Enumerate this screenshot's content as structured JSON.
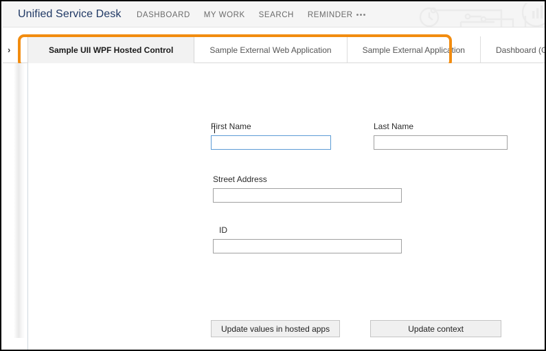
{
  "window": {
    "app_title": "Unified Service Desk"
  },
  "header": {
    "title": "Unified Service Desk",
    "nav": [
      {
        "label": "DASHBOARD",
        "name": "nav-dashboard"
      },
      {
        "label": "MY WORK",
        "name": "nav-my-work"
      },
      {
        "label": "SEARCH",
        "name": "nav-search"
      },
      {
        "label": "REMINDER",
        "name": "nav-reminder"
      }
    ],
    "overflow_icon": "ellipsis-icon",
    "watermark_icons": [
      "clock-icon",
      "circuit-lines-icon",
      "bar-chart-circle-icon"
    ],
    "title_color": "#1f3864",
    "background": "#f5f5f5"
  },
  "tabstrip": {
    "expand_chevron": "›",
    "tabs": [
      {
        "label": "Sample UII WPF Hosted Control",
        "active": true
      },
      {
        "label": "Sample External Web Application",
        "active": false
      },
      {
        "label": "Sample External Application",
        "active": false
      },
      {
        "label": "Dashboard (Global)",
        "active": false
      }
    ]
  },
  "annotation": {
    "shape": "rounded-rectangle-highlight",
    "color": "#f28c10"
  },
  "form": {
    "fields": [
      {
        "label": "First Name",
        "value": "",
        "placeholder": "",
        "focused": true
      },
      {
        "label": "Last Name",
        "value": "",
        "placeholder": "",
        "focused": false
      },
      {
        "label": "Street Address",
        "value": "",
        "placeholder": "",
        "focused": false
      },
      {
        "label": "ID",
        "value": "",
        "placeholder": "",
        "focused": false
      }
    ]
  },
  "buttons": {
    "update_values": "Update values in hosted apps",
    "update_context": "Update context"
  }
}
